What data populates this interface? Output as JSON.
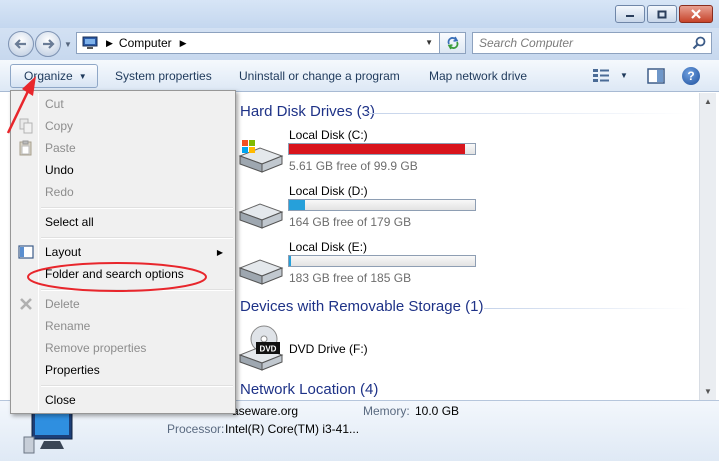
{
  "address": {
    "crumbs": [
      "Computer"
    ],
    "search_placeholder": "Search Computer"
  },
  "toolbar": {
    "organize": "Organize",
    "items": [
      "System properties",
      "Uninstall or change a program",
      "Map network drive"
    ],
    "help": "?"
  },
  "content": {
    "groups": {
      "hard_disks": "Hard Disk Drives (3)",
      "removable": "Devices with Removable Storage (1)",
      "network": "Network Location (4)"
    },
    "drives": [
      {
        "name": "Local Disk (C:)",
        "free": "5.61 GB free of 99.9 GB",
        "used_fraction": 0.944,
        "bar_color": "#d8141c"
      },
      {
        "name": "Local Disk (D:)",
        "free": "164 GB free of 179 GB",
        "used_fraction": 0.084,
        "bar_color": "#26a0da"
      },
      {
        "name": "Local Disk (E:)",
        "free": "183 GB free of 185 GB",
        "used_fraction": 0.011,
        "bar_color": "#26a0da"
      }
    ],
    "dvd": {
      "name": "DVD Drive (F:)",
      "label": "DVD"
    }
  },
  "details": {
    "domain_partial": "aseware.org",
    "memory_label": "Memory:",
    "memory_value": "10.0 GB",
    "processor_label": "Processor:",
    "processor_value": "Intel(R) Core(TM) i3-41..."
  },
  "menu": {
    "items": [
      {
        "label": "Cut",
        "enabled": false
      },
      {
        "label": "Copy",
        "enabled": false
      },
      {
        "label": "Paste",
        "enabled": false
      },
      {
        "label": "Undo",
        "enabled": true
      },
      {
        "label": "Redo",
        "enabled": false
      },
      {
        "label": "Select all",
        "enabled": true
      },
      {
        "label": "Layout",
        "enabled": true
      },
      {
        "label": "Folder and search options",
        "enabled": true
      },
      {
        "label": "Delete",
        "enabled": false
      },
      {
        "label": "Rename",
        "enabled": false
      },
      {
        "label": "Remove properties",
        "enabled": false
      },
      {
        "label": "Properties",
        "enabled": true
      },
      {
        "label": "Close",
        "enabled": true
      }
    ]
  },
  "colors": {
    "annotation": "#e8262c",
    "group_header": "#1e3287",
    "toolbar_text": "#1e395b"
  }
}
